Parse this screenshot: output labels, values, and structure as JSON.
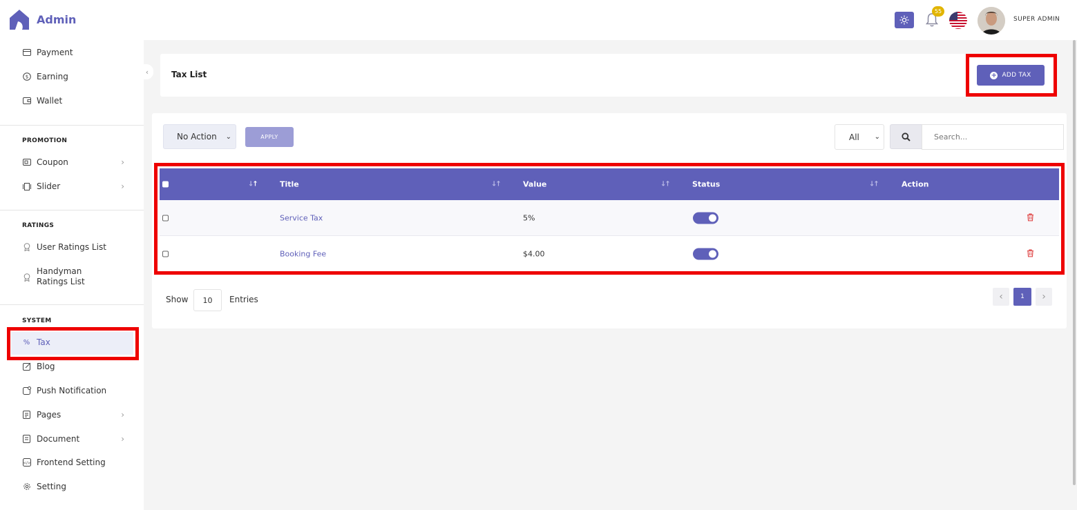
{
  "brand": {
    "name": "Admin"
  },
  "sidebar": {
    "items_top": [
      {
        "label": "Payment",
        "icon": "credit-card-icon"
      },
      {
        "label": "Earning",
        "icon": "dollar-circle-icon"
      },
      {
        "label": "Wallet",
        "icon": "wallet-icon"
      }
    ],
    "promotion": {
      "title": "PROMOTION",
      "items": [
        {
          "label": "Coupon",
          "icon": "ticket-icon"
        },
        {
          "label": "Slider",
          "icon": "slider-icon"
        }
      ]
    },
    "ratings": {
      "title": "RATINGS",
      "items": [
        {
          "label": "User Ratings List",
          "icon": "badge-icon"
        },
        {
          "label": "Handyman Ratings List",
          "icon": "badge-icon"
        }
      ]
    },
    "system": {
      "title": "SYSTEM",
      "items": [
        {
          "label": "Tax",
          "icon": "percent-icon"
        },
        {
          "label": "Blog",
          "icon": "edit-icon"
        },
        {
          "label": "Push Notification",
          "icon": "notification-icon"
        },
        {
          "label": "Pages",
          "icon": "pages-icon"
        },
        {
          "label": "Document",
          "icon": "document-icon"
        },
        {
          "label": "Frontend Setting",
          "icon": "code-icon"
        },
        {
          "label": "Setting",
          "icon": "gear-icon"
        }
      ]
    }
  },
  "header": {
    "notification_count": "55",
    "user_name": "SUPER ADMIN"
  },
  "page": {
    "title": "Tax List",
    "add_button": "ADD TAX"
  },
  "toolbar": {
    "bulk_action": "No Action",
    "apply_label": "APPLY",
    "filter": "All",
    "search_placeholder": "Search..."
  },
  "table": {
    "columns": [
      "Title",
      "Value",
      "Status",
      "Action"
    ],
    "rows": [
      {
        "title": "Service Tax",
        "value": "5%",
        "status": true
      },
      {
        "title": "Booking Fee",
        "value": "$4.00",
        "status": true
      }
    ]
  },
  "footer": {
    "show_label": "Show",
    "page_size": "10",
    "entries_label": "Entries",
    "current_page": "1"
  },
  "colors": {
    "accent": "#5f60b9",
    "highlight": "#ee0000",
    "delete": "#e04a4a"
  }
}
